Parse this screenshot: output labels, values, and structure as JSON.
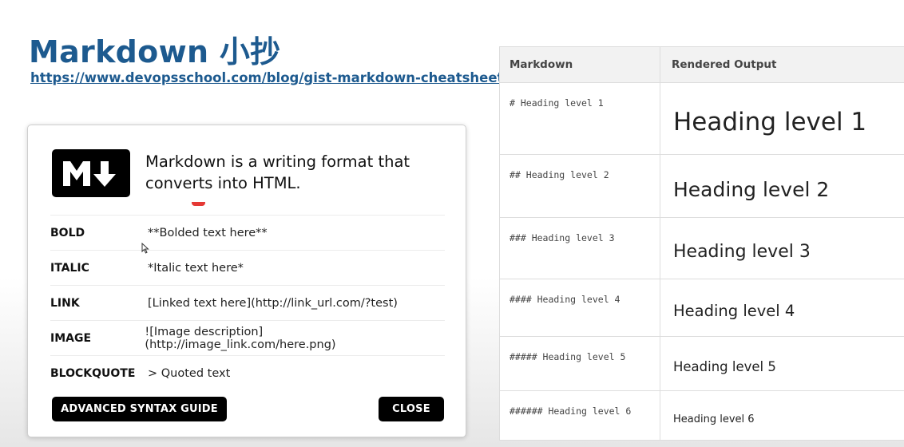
{
  "slide": {
    "title": "Markdown 小抄",
    "link": "https://www.devopsschool.com/blog/gist-markdown-cheatsheet/"
  },
  "dialog": {
    "logo_icon": "markdown-logo",
    "intro": "Markdown is a writing format that converts into HTML.",
    "rows": [
      {
        "label": "BOLD",
        "value": "**Bolded text here**"
      },
      {
        "label": "ITALIC",
        "value": "*Italic text here*"
      },
      {
        "label": "LINK",
        "value": "[Linked text here](http://link_url.com/?test)"
      },
      {
        "label": "IMAGE",
        "value": "![Image description](http://image_link.com/here.png)"
      },
      {
        "label": "BLOCKQUOTE",
        "value": "> Quoted text"
      }
    ],
    "advanced_button": "ADVANCED SYNTAX GUIDE",
    "close_button": "CLOSE"
  },
  "table": {
    "headers": {
      "markdown": "Markdown",
      "output": "Rendered Output"
    },
    "rows": [
      {
        "markdown": "# Heading level 1",
        "output": "Heading level 1"
      },
      {
        "markdown": "## Heading level 2",
        "output": "Heading level 2"
      },
      {
        "markdown": "### Heading level 3",
        "output": "Heading level 3"
      },
      {
        "markdown": "#### Heading level 4",
        "output": "Heading level 4"
      },
      {
        "markdown": "##### Heading level 5",
        "output": "Heading level 5"
      },
      {
        "markdown": "###### Heading level 6",
        "output": "Heading level 6"
      }
    ]
  },
  "colors": {
    "title": "#1d5a8f",
    "accent_mark": "#e53935",
    "button": "#000000"
  }
}
